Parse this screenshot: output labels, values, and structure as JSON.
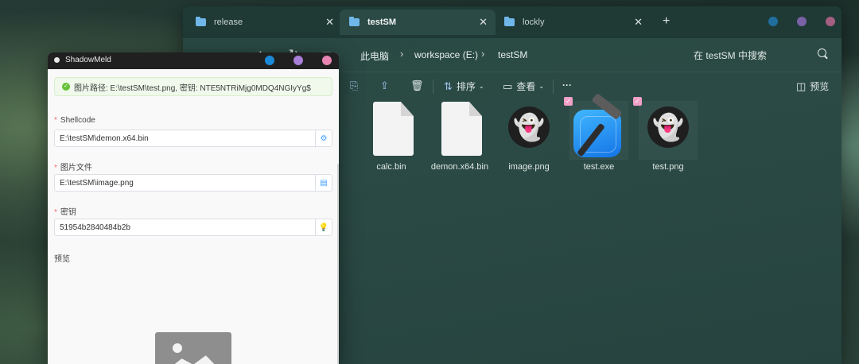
{
  "explorer": {
    "tabs": [
      {
        "label": "release",
        "active": false
      },
      {
        "label": "testSM",
        "active": true
      },
      {
        "label": "lockly",
        "active": false
      }
    ],
    "new_tab": "+",
    "close_glyph": "✕",
    "nav": {
      "back": "←",
      "forward": "→",
      "up": "↑",
      "refresh": "↻",
      "view": "▭"
    },
    "breadcrumb": [
      "此电脑",
      "workspace (E:)",
      "testSM"
    ],
    "breadcrumb_sep": "›",
    "search_placeholder": "在 testSM 中搜索",
    "toolbar": {
      "sort_label": "排序",
      "view_label": "查看",
      "more": "···",
      "preview_label": "预览"
    },
    "files": [
      {
        "name": "calc.bin",
        "type": "document"
      },
      {
        "name": "demon.x64.bin",
        "type": "document"
      },
      {
        "name": "image.png",
        "type": "ghost-image"
      },
      {
        "name": "test.exe",
        "type": "xcode-app",
        "selected": true
      },
      {
        "name": "test.png",
        "type": "ghost-image",
        "selected": true
      }
    ]
  },
  "shadowmeld": {
    "title": "ShadowMeld",
    "alert_text": "图片路径: E:\\testSM\\test.png, 密钥: NTE5NTRiMjg0MDQ4NGIyYg$",
    "fields": [
      {
        "label": "Shellcode",
        "value": "E:\\testSM\\demon.x64.bin",
        "icon": "bug-icon"
      },
      {
        "label": "图片文件",
        "value": "E:\\testSM\\image.png",
        "icon": "file-icon"
      },
      {
        "label": "密钥",
        "value": "51954b2840484b2b",
        "icon": "bulb-icon"
      }
    ],
    "preview_label": "预览"
  },
  "colors": {
    "dot_blue": "#1a8ad8",
    "dot_purple": "#a77ed8",
    "dot_pink": "#e885b3",
    "accent": "#409eff",
    "success": "#67c23a",
    "required": "#f56c6c"
  }
}
